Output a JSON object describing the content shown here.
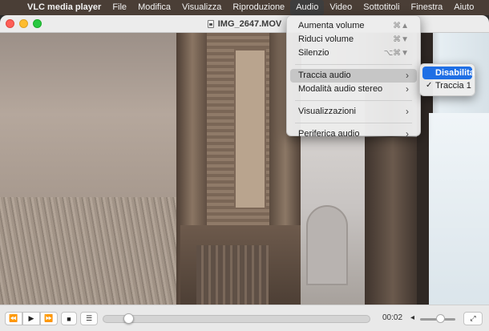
{
  "menubar": {
    "apple_icon": "apple-logo-icon",
    "app_name": "VLC media player",
    "items": [
      "File",
      "Modifica",
      "Visualizza",
      "Riproduzione",
      "Audio",
      "Video",
      "Sottotitoli",
      "Finestra",
      "Aiuto"
    ],
    "active_item": "Audio"
  },
  "window": {
    "title": "IMG_2647.MOV"
  },
  "audio_menu": {
    "items": [
      {
        "label": "Aumenta volume",
        "shortcut": "⌘▲"
      },
      {
        "label": "Riduci volume",
        "shortcut": "⌘▼"
      },
      {
        "label": "Silenzio",
        "shortcut": "⌥⌘▼"
      },
      {
        "label": "Traccia audio",
        "submenu": true,
        "highlighted": true
      },
      {
        "label": "Modalità audio stereo",
        "submenu": true
      },
      {
        "label": "Visualizzazioni",
        "submenu": true
      },
      {
        "label": "Periferica audio",
        "submenu": true
      }
    ]
  },
  "track_submenu": {
    "items": [
      {
        "label": "Disabilita",
        "selected": true
      },
      {
        "label": "Traccia 1",
        "checked": true
      }
    ]
  },
  "controls": {
    "rewind_icon": "⏪",
    "play_icon": "▶",
    "forward_icon": "⏩",
    "stop_icon": "■",
    "playlist_icon": "☰",
    "time": "00:02",
    "fullscreen_icon": "⤢",
    "progress_fraction": 0.08,
    "volume_fraction": 0.6
  }
}
